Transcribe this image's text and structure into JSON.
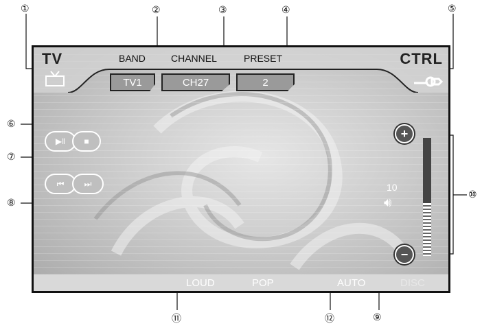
{
  "callouts": [
    "①",
    "②",
    "③",
    "④",
    "⑤",
    "⑥",
    "⑦",
    "⑧",
    "⑨",
    "⑩",
    "⑪",
    "⑫"
  ],
  "header": {
    "tv_logo": "TV",
    "ctrl_logo": "CTRL",
    "band_label": "BAND",
    "channel_label": "CHANNEL",
    "preset_label": "PRESET",
    "band_value": "TV1",
    "channel_value": "CH27",
    "preset_value": "2"
  },
  "controls": {
    "play_pause_icon": "play-pause-icon",
    "stop_icon": "stop-icon",
    "prev_icon": "skip-previous-icon",
    "next_icon": "skip-next-icon",
    "vol_up": "+",
    "vol_down": "−"
  },
  "volume": {
    "value": "10",
    "level": 0.45
  },
  "status": {
    "loud": "LOUD",
    "pop": "POP",
    "auto": "AUTO",
    "disc": "DISC"
  }
}
